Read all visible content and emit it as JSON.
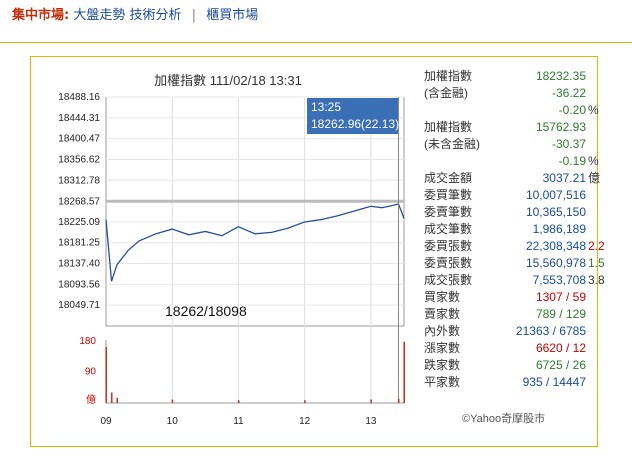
{
  "header": {
    "title": "集中市場:",
    "link1": "大盤走勢",
    "link2": "技術分析",
    "separator": "|",
    "link3": "櫃買市場"
  },
  "chart": {
    "title": "加權指數 111/02/18 13:31",
    "hilo": "18262/18098",
    "tooltip": {
      "time": "13:25",
      "value": "18262.96(22.13)"
    },
    "credit": "©Yahoo奇摩股市"
  },
  "stats": [
    {
      "label": "加權指數",
      "value": "18232.35",
      "color": "#2f7a2f"
    },
    {
      "label": "(含金融)",
      "value": "-36.22",
      "color": "#2f7a2f"
    },
    {
      "label": "",
      "value": "-0.20",
      "color": "#2f7a2f",
      "suffix": "%"
    },
    {
      "label": "加權指數",
      "value": "15762.93",
      "color": "#2f7a2f"
    },
    {
      "label": "(未含金融)",
      "value": "-30.37",
      "color": "#2f7a2f"
    },
    {
      "label": "",
      "value": "-0.19",
      "color": "#2f7a2f",
      "suffix": "%"
    },
    {
      "label": "成交金額",
      "value": "3037.21",
      "color": "#1a4a99",
      "suffix": "億"
    },
    {
      "label": "委買筆數",
      "value": "10,007,516",
      "color": "#1a4a99"
    },
    {
      "label": "委賣筆數",
      "value": "10,365,150",
      "color": "#1a4a99"
    },
    {
      "label": "成交筆數",
      "value": "1,986,189",
      "color": "#1a4a99"
    },
    {
      "label": "委買張數",
      "value": "22,308,348",
      "color": "#1a4a99",
      "extra": "2.2",
      "extracolor": "#c00"
    },
    {
      "label": "委賣張數",
      "value": "15,560,978",
      "color": "#1a4a99",
      "extra": "1.5",
      "extracolor": "#2f7a2f"
    },
    {
      "label": "成交張數",
      "value": "7,553,708",
      "color": "#1a4a99",
      "extra": "3.8",
      "extracolor": "#333"
    },
    {
      "label": "買家數",
      "value": "1307 / 59",
      "color": "#c00"
    },
    {
      "label": "賣家數",
      "value": "789 / 129",
      "color": "#2f7a2f"
    },
    {
      "label": "內外數",
      "value": "21363 / 6785",
      "color": "#1a4a99"
    },
    {
      "label": "漲家數",
      "value": "6620 / 12",
      "color": "#c00"
    },
    {
      "label": "跌家數",
      "value": "6725 / 26",
      "color": "#2f7a2f"
    },
    {
      "label": "平家數",
      "value": "935 / 14447",
      "color": "#1a4a99"
    }
  ],
  "chart_data": {
    "type": "line",
    "title": "加權指數 111/02/18 13:31",
    "yticks": [
      "18488.16",
      "18444.31",
      "18400.47",
      "18356.62",
      "18312.78",
      "18268.57",
      "18225.09",
      "18181.25",
      "18137.40",
      "18093.56",
      "18049.71"
    ],
    "ylim": [
      18005.86,
      18488.16
    ],
    "reference_line": 18268.57,
    "xticks": [
      "09",
      "10",
      "11",
      "12",
      "13"
    ],
    "volume_ticks": [
      "180",
      "90",
      "億"
    ],
    "index_series": {
      "x": [
        "09:00",
        "09:05",
        "09:10",
        "09:20",
        "09:30",
        "09:45",
        "10:00",
        "10:15",
        "10:30",
        "10:45",
        "11:00",
        "11:15",
        "11:30",
        "11:45",
        "12:00",
        "12:15",
        "12:30",
        "12:45",
        "13:00",
        "13:10",
        "13:20",
        "13:25",
        "13:30"
      ],
      "values": [
        18230,
        18100,
        18135,
        18165,
        18185,
        18200,
        18210,
        18198,
        18205,
        18196,
        18215,
        18200,
        18203,
        18212,
        18225,
        18230,
        18238,
        18248,
        18258,
        18255,
        18260,
        18262.96,
        18232.35
      ]
    },
    "volume_series": {
      "x": [
        "09:00",
        "09:05",
        "09:10",
        "10:00",
        "11:00",
        "12:00",
        "13:00",
        "13:25",
        "13:30"
      ],
      "values": [
        160,
        30,
        15,
        10,
        8,
        8,
        10,
        12,
        175
      ]
    }
  }
}
